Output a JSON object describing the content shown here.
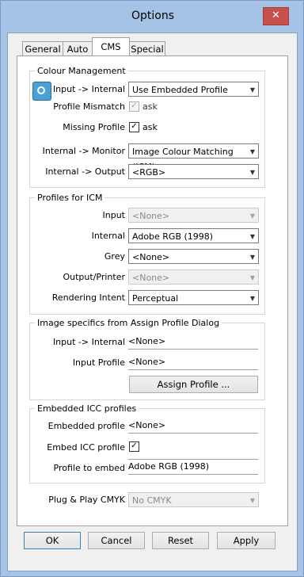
{
  "window": {
    "title": "Options",
    "close_glyph": "✕"
  },
  "tabs": [
    "General",
    "Auto",
    "CMS",
    "Special"
  ],
  "colour_management": {
    "group_label": "Colour Management",
    "input_internal": {
      "label": "Input -> Internal",
      "value": "Use Embedded Profile"
    },
    "profile_mismatch": {
      "label": "Profile Mismatch",
      "checked": true,
      "enabled": false,
      "text": "ask"
    },
    "missing_profile": {
      "label": "Missing Profile",
      "checked": true,
      "enabled": true,
      "text": "ask"
    },
    "internal_monitor": {
      "label": "Internal -> Monitor",
      "value": "Image Colour Matching (ICM)"
    },
    "internal_output": {
      "label": "Internal -> Output",
      "value": "<RGB>"
    }
  },
  "profiles_icm": {
    "group_label": "Profiles for ICM",
    "input": {
      "label": "Input",
      "value": "<None>",
      "enabled": false
    },
    "internal": {
      "label": "Internal",
      "value": "Adobe RGB (1998)",
      "enabled": true
    },
    "grey": {
      "label": "Grey",
      "value": "<None>",
      "enabled": true
    },
    "output_printer": {
      "label": "Output/Printer",
      "value": "<None>",
      "enabled": false
    },
    "rendering_intent": {
      "label": "Rendering Intent",
      "value": "Perceptual",
      "enabled": true
    }
  },
  "image_specifics": {
    "group_label": "Image specifics from Assign Profile Dialog",
    "input_internal": {
      "label": "Input -> Internal",
      "value": "<None>"
    },
    "input_profile": {
      "label": "Input Profile",
      "value": "<None>"
    },
    "assign_button": "Assign Profile ..."
  },
  "embedded_icc": {
    "group_label": "Embedded ICC profiles",
    "embedded_profile": {
      "label": "Embedded profile",
      "value": "<None>"
    },
    "embed_icc_profile": {
      "label": "Embed ICC profile",
      "checked": true
    },
    "profile_to_embed": {
      "label": "Profile to embed",
      "value": "Adobe RGB (1998)"
    }
  },
  "plug_play": {
    "label": "Plug & Play CMYK",
    "value": "No CMYK",
    "enabled": false
  },
  "buttons": {
    "ok": "OK",
    "cancel": "Cancel",
    "reset": "Reset",
    "apply": "Apply"
  },
  "icons": {
    "app_icon": "cms-app-icon",
    "check_glyph": "✓",
    "arrow_glyph": "▼"
  }
}
